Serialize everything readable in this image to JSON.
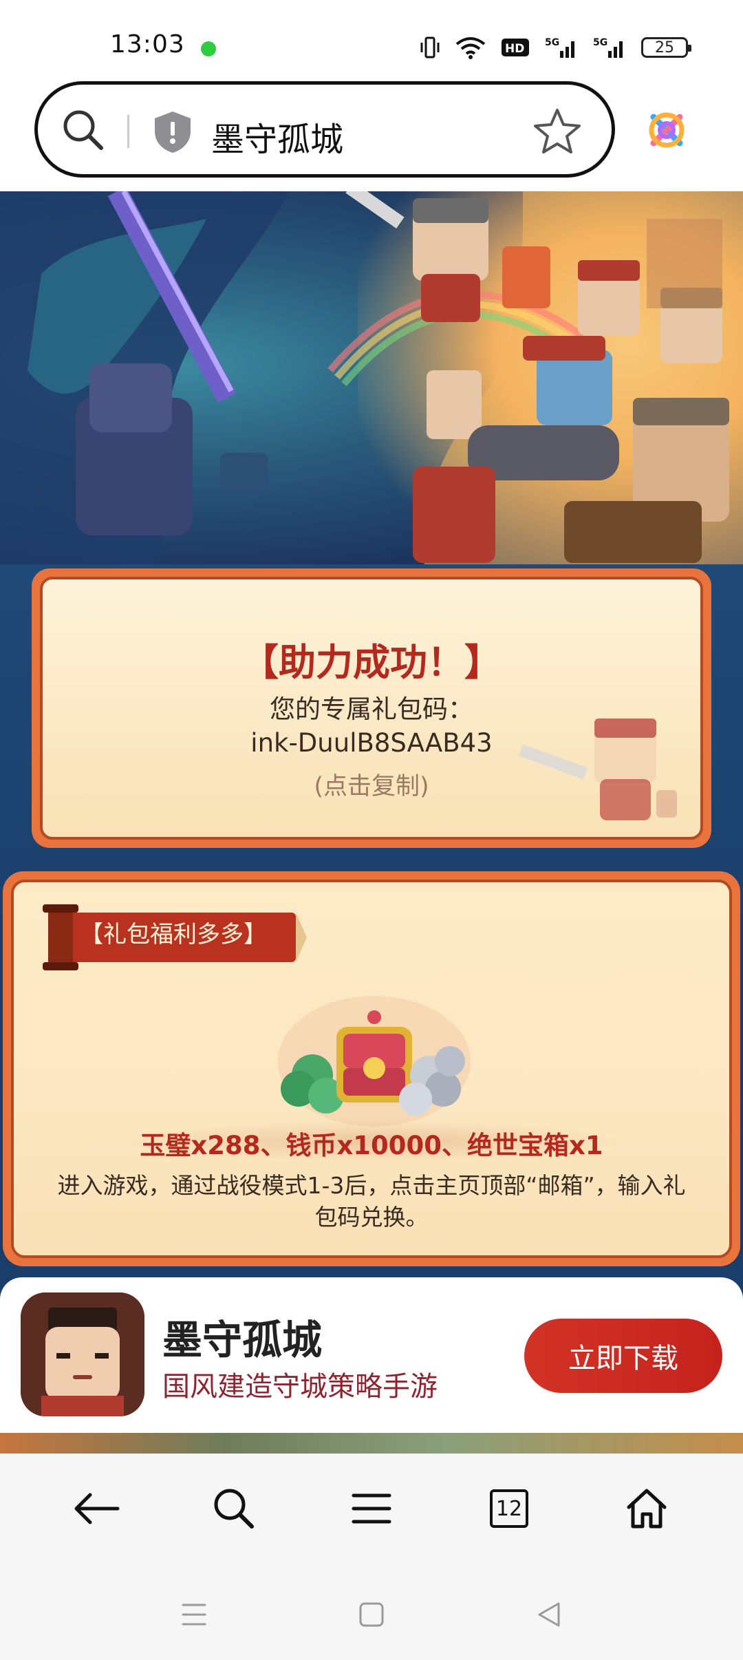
{
  "status_bar": {
    "time": "13:03",
    "battery": "25",
    "icons": [
      "vibrate-icon",
      "wifi-icon",
      "hd-icon",
      "signal-5g-icon",
      "signal-5g-icon",
      "battery-icon"
    ]
  },
  "address_bar": {
    "title": "墨守孤城"
  },
  "success_card": {
    "title": "【助力成功！】",
    "subtitle": "您的专属礼包码：",
    "code": "ink-DuulB8SAAB43",
    "copy_hint": "(点击复制)"
  },
  "gift_card": {
    "ribbon_label": "【礼包福利多多】",
    "rewards": "玉璧x288、钱币x10000、绝世宝箱x1",
    "description": "进入游戏，通过战役模式1-3后，点击主页顶部“邮箱”，输入礼包码兑换。"
  },
  "app_bar": {
    "name": "墨守孤城",
    "tagline": "国风建造守城策略手游",
    "download_label": "立即下载"
  },
  "bottom_nav": {
    "tabs_count": "12"
  },
  "colors": {
    "accent_red": "#b4281e",
    "button_red": "#d33326",
    "card_orange": "#e8733c"
  }
}
